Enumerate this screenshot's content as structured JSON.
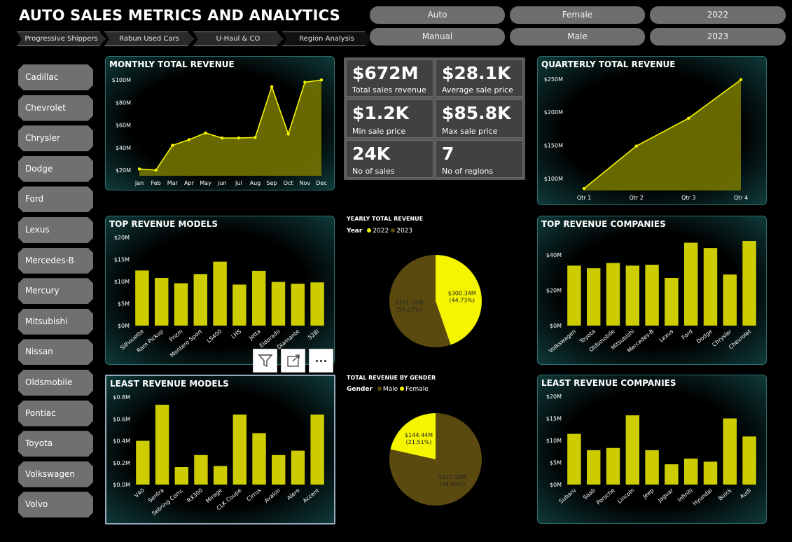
{
  "title": "AUTO SALES METRICS AND ANALYTICS",
  "colors": {
    "accent": "#f5f500",
    "bar": "#cccc00",
    "dark_slice": "#5a4a10",
    "panel_border": "#2f6f6f"
  },
  "nav": {
    "items": [
      {
        "label": "Progressive Shippers"
      },
      {
        "label": "Rabun Used Cars"
      },
      {
        "label": "U-Haul & CO"
      },
      {
        "label": "Region Analysis"
      }
    ]
  },
  "filters": {
    "row1": [
      {
        "label": "Auto"
      },
      {
        "label": "Female"
      },
      {
        "label": "2022"
      }
    ],
    "row2": [
      {
        "label": "Manual"
      },
      {
        "label": "Male"
      },
      {
        "label": "2023"
      }
    ]
  },
  "sidebar": {
    "items": [
      {
        "label": "Cadillac"
      },
      {
        "label": "Chevrolet"
      },
      {
        "label": "Chrysler"
      },
      {
        "label": "Dodge"
      },
      {
        "label": "Ford"
      },
      {
        "label": "Lexus"
      },
      {
        "label": "Mercedes-B"
      },
      {
        "label": "Mercury"
      },
      {
        "label": "Mitsubishi"
      },
      {
        "label": "Nissan"
      },
      {
        "label": "Oldsmobile"
      },
      {
        "label": "Pontiac"
      },
      {
        "label": "Toyota"
      },
      {
        "label": "Volkswagen"
      },
      {
        "label": "Volvo"
      }
    ]
  },
  "kpis": [
    {
      "value": "$672M",
      "label": "Total sales revenue"
    },
    {
      "value": "$28.1K",
      "label": "Average sale price"
    },
    {
      "value": "$1.2K",
      "label": "Min sale price"
    },
    {
      "value": "$85.8K",
      "label": "Max sale price"
    },
    {
      "value": "24K",
      "label": "No of sales"
    },
    {
      "value": "7",
      "label": "No of regions"
    }
  ],
  "toolbar": {
    "filter_icon": "filter-icon",
    "focus_icon": "focus-mode-icon",
    "more_icon": "more-options-icon",
    "more_label": "···"
  },
  "chart_data": [
    {
      "id": "monthly",
      "type": "area",
      "title": "MONTHLY TOTAL REVENUE",
      "categories": [
        "Jan",
        "Feb",
        "Mar",
        "Apr",
        "May",
        "Jun",
        "Jul",
        "Aug",
        "Sep",
        "Oct",
        "Nov",
        "Dec"
      ],
      "values": [
        21,
        20,
        42,
        47,
        53,
        48.5,
        48.5,
        49,
        94,
        52,
        98,
        100
      ],
      "yticks": [
        "$20M",
        "$40M",
        "$60M",
        "$80M",
        "$100M"
      ],
      "ylim": [
        15,
        102
      ],
      "ytick_vals": [
        20,
        40,
        60,
        80,
        100
      ]
    },
    {
      "id": "quarterly",
      "type": "area",
      "title": "QUARTERLY TOTAL REVENUE",
      "categories": [
        "Qtr 1",
        "Qtr 2",
        "Qtr 3",
        "Qtr 4"
      ],
      "values": [
        85,
        149,
        191,
        249
      ],
      "yticks": [
        "$100M",
        "$150M",
        "$200M",
        "$250M"
      ],
      "ylim": [
        82,
        252
      ],
      "ytick_vals": [
        100,
        150,
        200,
        250
      ]
    },
    {
      "id": "top_models",
      "type": "bar",
      "title": "TOP REVENUE MODELS",
      "categories": [
        "Silhouette",
        "Ram Pickup",
        "Prizm",
        "Montero Sport",
        "LS400",
        "LHS",
        "Jetta",
        "Eldorado",
        "Diamante",
        "528i"
      ],
      "values": [
        12.5,
        10.8,
        9.6,
        11.7,
        14.5,
        9.3,
        12.4,
        9.9,
        9.5,
        9.8
      ],
      "yticks": [
        "$0M",
        "$5M",
        "$10M",
        "$15M",
        "$20M"
      ],
      "ylim": [
        0,
        20
      ],
      "ytick_vals": [
        0,
        5,
        10,
        15,
        20
      ]
    },
    {
      "id": "top_companies",
      "type": "bar",
      "title": "TOP REVENUE COMPANIES",
      "categories": [
        "Volkswagen",
        "Toyota",
        "Oldsmobile",
        "Mitsubishi",
        "Mercedes-B",
        "Lexus",
        "Ford",
        "Dodge",
        "Chrysler",
        "Chevrolet"
      ],
      "values": [
        34,
        32.5,
        35.5,
        34,
        34.5,
        27,
        47,
        44,
        29,
        48
      ],
      "yticks": [
        "$0M",
        "$20M",
        "$40M"
      ],
      "ylim": [
        0,
        50
      ],
      "ytick_vals": [
        0,
        20,
        40
      ]
    },
    {
      "id": "least_models",
      "type": "bar",
      "title": "LEAST REVENUE MODELS",
      "categories": [
        "V40",
        "Sentra",
        "Sebring Conv.",
        "RX300",
        "Mirage",
        "CLK Coupe",
        "Cirrus",
        "Avalon",
        "Alero",
        "Accent"
      ],
      "values": [
        0.4,
        0.73,
        0.16,
        0.27,
        0.17,
        0.64,
        0.47,
        0.27,
        0.31,
        0.64
      ],
      "yticks": [
        "$0.0M",
        "$0.2M",
        "$0.4M",
        "$0.6M",
        "$0.8M"
      ],
      "ylim": [
        0,
        0.8
      ],
      "ytick_vals": [
        0,
        0.2,
        0.4,
        0.6,
        0.8
      ]
    },
    {
      "id": "least_companies",
      "type": "bar",
      "title": "LEAST REVENUE COMPANIES",
      "categories": [
        "Subaru",
        "Saab",
        "Porsche",
        "Lincoln",
        "Jeep",
        "Jaguar",
        "Infiniti",
        "Hyundai",
        "Buick",
        "Audi"
      ],
      "values": [
        11.5,
        7.8,
        8.3,
        15.7,
        7.8,
        4.6,
        5.9,
        5.2,
        15,
        10.9
      ],
      "yticks": [
        "$0M",
        "$5M",
        "$10M",
        "$15M",
        "$20M"
      ],
      "ylim": [
        0,
        20
      ],
      "ytick_vals": [
        0,
        5,
        10,
        15,
        20
      ]
    },
    {
      "id": "yearly_pie",
      "type": "pie",
      "title": "YEARLY TOTAL REVENUE",
      "legend_title": "Year",
      "slices": [
        {
          "name": "2022",
          "value": 300.34,
          "label": "$300.34M",
          "pct": "(44.73%)",
          "color": "#f5f500"
        },
        {
          "name": "2023",
          "value": 371.19,
          "label": "$371.19M",
          "pct": "(55.27%)",
          "color": "#5a4a10"
        }
      ]
    },
    {
      "id": "gender_pie",
      "type": "pie",
      "title": "TOTAL REVENUE BY GENDER",
      "legend_title": "Gender",
      "slices": [
        {
          "name": "Male",
          "value": 527.09,
          "label": "$527.09M",
          "pct": "(78.49%)",
          "color": "#5a4a10"
        },
        {
          "name": "Female",
          "value": 144.44,
          "label": "$144.44M",
          "pct": "(21.51%)",
          "color": "#f5f500"
        }
      ]
    }
  ]
}
